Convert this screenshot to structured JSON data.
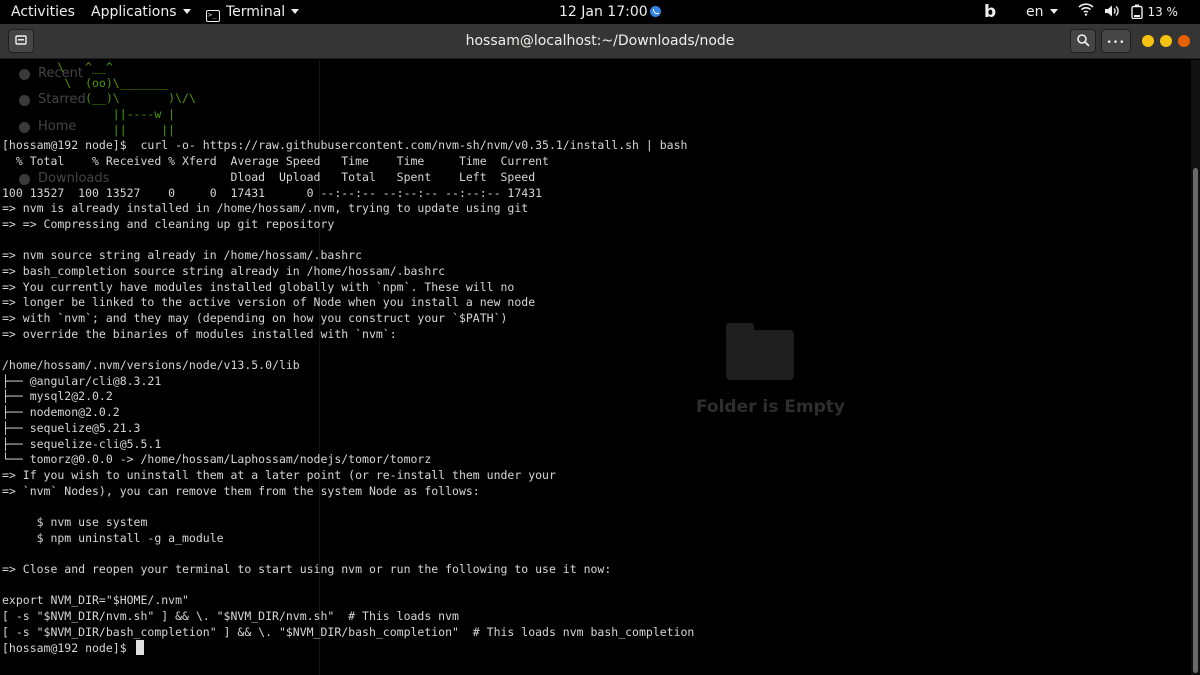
{
  "topbar": {
    "activities": "Activities",
    "applications": "Applications",
    "app_menu": "Terminal",
    "clock": "12 Jan  17:00",
    "language": "en",
    "battery": "13 %",
    "icons": [
      "terminal-icon",
      "bing-icon",
      "wifi-icon",
      "volume-icon",
      "battery-icon"
    ]
  },
  "headerbar": {
    "title": "hossam@localhost:~/Downloads/node",
    "search_icon": "⌕",
    "menu_icon": "•••"
  },
  "background": {
    "sidebar": [
      "Recent",
      "Starred",
      "Home",
      "Downloads"
    ],
    "empty_label": "Folder is Empty"
  },
  "terminal": {
    "ascii_art": [
      "        \\   ^__^",
      "         \\  (oo)\\_______",
      "            (__)\\       )\\/\\",
      "                ||----w |",
      "                ||     ||"
    ],
    "lines": [
      "[hossam@192 node]$  curl -o- https://raw.githubusercontent.com/nvm-sh/nvm/v0.35.1/install.sh | bash",
      "  % Total    % Received % Xferd  Average Speed   Time    Time     Time  Current",
      "                                 Dload  Upload   Total   Spent    Left  Speed",
      "100 13527  100 13527    0     0  17431      0 --:--:-- --:--:-- --:--:-- 17431",
      "=> nvm is already installed in /home/hossam/.nvm, trying to update using git",
      "=> => Compressing and cleaning up git repository",
      "",
      "=> nvm source string already in /home/hossam/.bashrc",
      "=> bash_completion source string already in /home/hossam/.bashrc",
      "=> You currently have modules installed globally with `npm`. These will no",
      "=> longer be linked to the active version of Node when you install a new node",
      "=> with `nvm`; and they may (depending on how you construct your `$PATH`)",
      "=> override the binaries of modules installed with `nvm`:",
      "",
      "/home/hossam/.nvm/versions/node/v13.5.0/lib",
      "├── @angular/cli@8.3.21",
      "├── mysql2@2.0.2",
      "├── nodemon@2.0.2",
      "├── sequelize@5.21.3",
      "├── sequelize-cli@5.5.1",
      "└── tomorz@0.0.0 -> /home/hossam/Laphossam/nodejs/tomor/tomorz",
      "=> If you wish to uninstall them at a later point (or re-install them under your",
      "=> `nvm` Nodes), you can remove them from the system Node as follows:",
      "",
      "     $ nvm use system",
      "     $ npm uninstall -g a_module",
      "",
      "=> Close and reopen your terminal to start using nvm or run the following to use it now:",
      "",
      "export NVM_DIR=\"$HOME/.nvm\"",
      "[ -s \"$NVM_DIR/nvm.sh\" ] && \\. \"$NVM_DIR/nvm.sh\"  # This loads nvm",
      "[ -s \"$NVM_DIR/bash_completion\" ] && \\. \"$NVM_DIR/bash_completion\"  # This loads nvm bash_completion"
    ],
    "prompt": "[hossam@192 node]$ "
  },
  "colors": {
    "terminal_bg": "#000000",
    "terminal_fg": "#d6d6d6",
    "ascii_green": "#4e9a06",
    "header_bg": "#353535",
    "close_button": "#e66100",
    "min_max_button": "#f5c211"
  }
}
